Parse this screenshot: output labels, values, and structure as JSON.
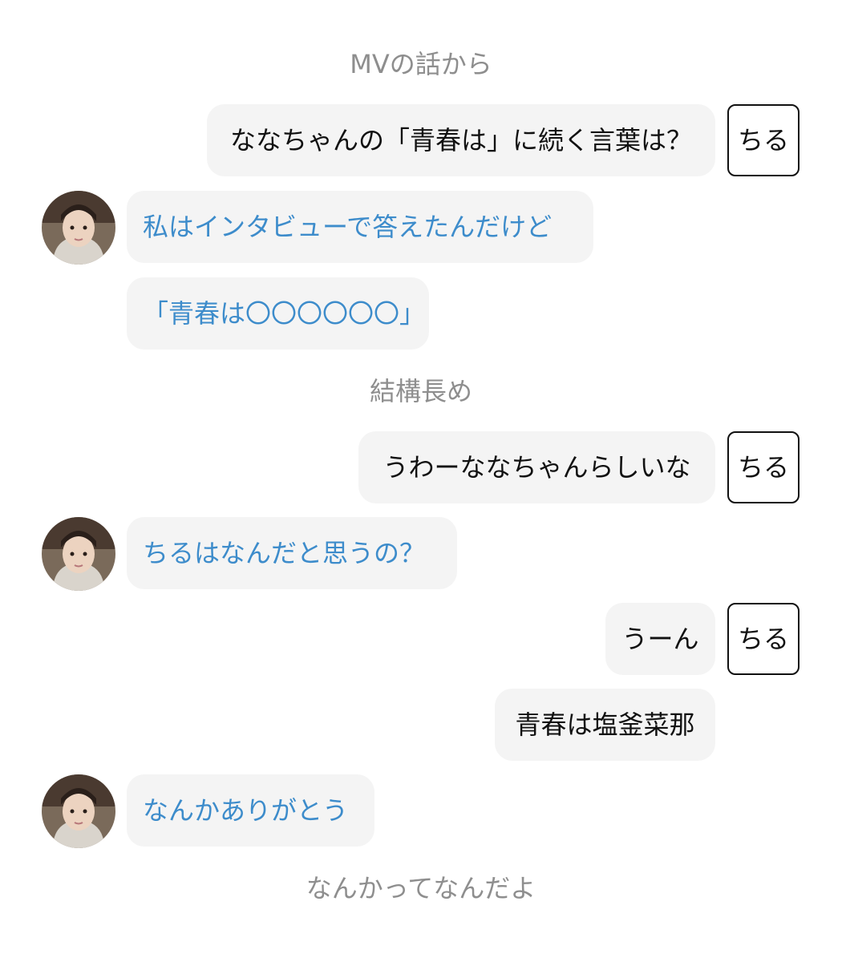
{
  "conversation": {
    "captions": [
      "MVの話から",
      "結構長め",
      "なんかってなんだよ"
    ],
    "tag_label": "ちる",
    "right_messages": [
      "ななちゃんの「青春は」に続く言葉は？",
      "うわーななちゃんらしいな",
      "うーん",
      "青春は塩釜菜那"
    ],
    "left_messages": [
      "私はインタビューで答えたんだけど",
      "「青春は〇〇〇〇〇〇」",
      "ちるはなんだと思うの？",
      "なんかありがとう"
    ]
  },
  "colors": {
    "left_text": "#3d8ccb",
    "right_text": "#111111",
    "caption_text": "#8e8e8e",
    "bubble_bg": "#f4f4f4"
  }
}
